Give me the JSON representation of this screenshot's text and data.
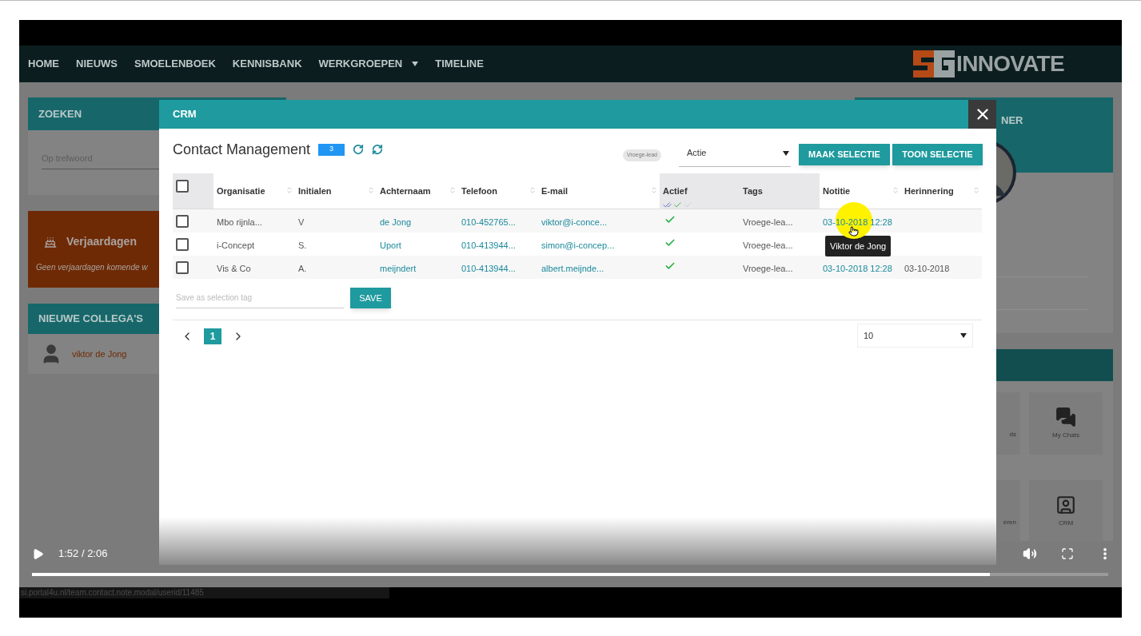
{
  "nav": {
    "items": [
      {
        "label": "HOME",
        "dropdown": false
      },
      {
        "label": "NIEUWS",
        "dropdown": false
      },
      {
        "label": "SMOELENBOEK",
        "dropdown": false
      },
      {
        "label": "KENNISBANK",
        "dropdown": false
      },
      {
        "label": "WERKGROEPEN",
        "dropdown": true
      },
      {
        "label": "TIMELINE",
        "dropdown": false
      }
    ],
    "logo": "INNOVATE"
  },
  "left": {
    "search": {
      "title": "ZOEKEN",
      "placeholder": "Op trefwoord"
    },
    "birthdays": {
      "title": "Verjaardagen",
      "text": "Geen verjaardagen komende w"
    },
    "colleagues": {
      "title": "NIEUWE COLLEGA'S",
      "items": [
        {
          "name": "viktor de Jong"
        }
      ]
    }
  },
  "right": {
    "profile_title": "NER",
    "tiles": [
      {
        "label": "ds",
        "kind": "partial"
      },
      {
        "label": "My Chats",
        "kind": "chats"
      },
      {
        "label": "eren",
        "kind": "partial"
      },
      {
        "label": "CRM",
        "kind": "crm"
      }
    ]
  },
  "modal": {
    "title": "CRM",
    "all_checked": false,
    "heading": "Contact Management",
    "count": "3",
    "tag_chip": "Vroege-lead",
    "action_select": "Actie",
    "buttons": [
      "MAAK SELECTIE",
      "TOON SELECTIE"
    ],
    "columns": [
      {
        "label": "Organisatie",
        "sortable": true,
        "shaded": false
      },
      {
        "label": "Initialen",
        "sortable": true,
        "shaded": false
      },
      {
        "label": "Achternaam",
        "sortable": true,
        "shaded": false
      },
      {
        "label": "Telefoon",
        "sortable": true,
        "shaded": false
      },
      {
        "label": "E-mail",
        "sortable": true,
        "shaded": false
      },
      {
        "label": "Actief",
        "sortable": false,
        "shaded": true
      },
      {
        "label": "Tags",
        "sortable": false,
        "shaded": true
      },
      {
        "label": "Notitie",
        "sortable": true,
        "shaded": false
      },
      {
        "label": "Herinnering",
        "sortable": true,
        "shaded": false
      }
    ],
    "rows": [
      {
        "checked": false,
        "organisatie": "Mbo rijnla...",
        "initialen": "V",
        "achternaam": "de Jong",
        "telefoon": "010-452765...",
        "email": "viktor@i-conce...",
        "actief": true,
        "tags": "Vroege-lea...",
        "notitie": "03-10-2018 12:28"
      },
      {
        "checked": false,
        "organisatie": "i-Concept",
        "initialen": "S.",
        "achternaam": "Uport",
        "telefoon": "010-413944...",
        "email": "simon@i-concep...",
        "actief": true,
        "tags": "Vroege-lea..."
      },
      {
        "checked": false,
        "organisatie": "Vis & Co",
        "initialen": "A.",
        "achternaam": "meijndert",
        "telefoon": "010-413944...",
        "email": "albert.meijnde...",
        "actief": true,
        "tags": "Vroege-lea...",
        "notitie": "03-10-2018 12:28",
        "herinnering": "03-10-2018"
      }
    ],
    "save_placeholder": "Save as selection tag",
    "save_button": "SAVE",
    "pages": [
      {
        "label": "1",
        "selected": true
      }
    ],
    "page_size": "10",
    "tooltip": "Viktor de Jong"
  },
  "video": {
    "time": "1:52 / 2:06",
    "progress": {
      "level": 0.89
    },
    "status_url": "si.portal4u.nl/team.contact.note.modal/userid/11485"
  }
}
